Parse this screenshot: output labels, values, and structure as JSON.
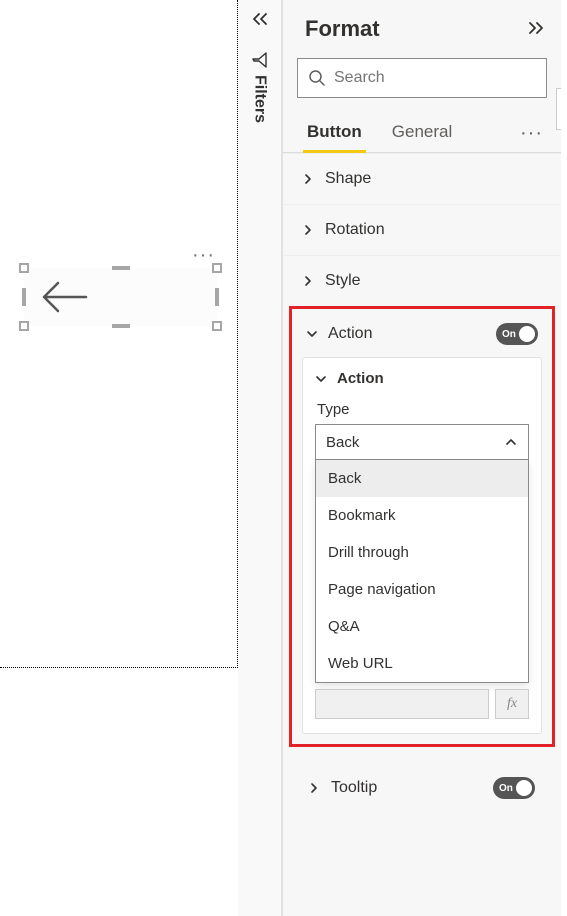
{
  "canvas": {
    "button_options_aria": "More options"
  },
  "filters_pane": {
    "label": "Filters"
  },
  "format_pane": {
    "title": "Format",
    "search_placeholder": "Search",
    "tabs": {
      "button": "Button",
      "general": "General"
    },
    "sections": {
      "shape": "Shape",
      "rotation": "Rotation",
      "style": "Style",
      "action": "Action",
      "tooltip": "Tooltip"
    },
    "toggle_on_label": "On",
    "action_card": {
      "subheader": "Action",
      "type_label": "Type",
      "selected": "Back",
      "options": [
        "Back",
        "Bookmark",
        "Drill through",
        "Page navigation",
        "Q&A",
        "Web URL"
      ],
      "fx_label": "fx"
    }
  }
}
